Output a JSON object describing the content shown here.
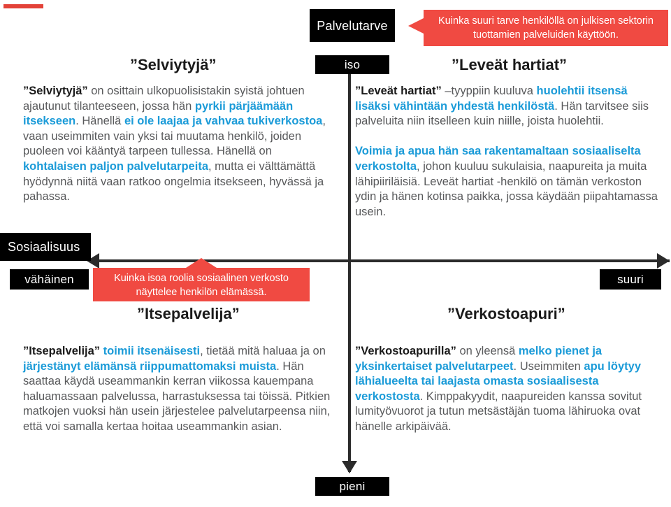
{
  "accent_color": "#e34238",
  "highlight_color": "#1b9bd8",
  "callout_color": "#f04a42",
  "axes": {
    "vertical_title": "Palvelutarve",
    "vertical_top_label": "iso",
    "vertical_bottom_label": "pieni",
    "horizontal_title": "Sosiaalisuus",
    "horizontal_left_label": "vähäinen",
    "horizontal_right_label": "suuri"
  },
  "callouts": {
    "service_need": "Kuinka suuri tarve henkilöllä on julkisen sektorin tuottamien palveluiden käyttöön.",
    "sociality": "Kuinka isoa roolia sosiaalinen verkosto näyttelee henkilön elämässä."
  },
  "quadrants": {
    "top_left": {
      "heading": "”Selviytyjä”",
      "body_parts": [
        {
          "text": "”Selviytyjä”",
          "style": "bold-dark"
        },
        {
          "text": " on osittain ulkopuolisistakin syistä johtuen ajautunut tilanteeseen, jossa hän ",
          "style": "plain"
        },
        {
          "text": "pyrkii pärjäämään itsekseen",
          "style": "highlight"
        },
        {
          "text": ". Hänellä ",
          "style": "plain"
        },
        {
          "text": "ei ole laajaa ja vahvaa tukiverkostoa",
          "style": "highlight"
        },
        {
          "text": ", vaan useimmiten vain yksi tai muutama henkilö, joiden puoleen voi kääntyä tarpeen tullessa. Hänellä on ",
          "style": "plain"
        },
        {
          "text": "kohtalaisen paljon palvelutarpeita",
          "style": "highlight"
        },
        {
          "text": ", mutta ei välttämättä hyödynnä niitä vaan ratkoo ongelmia itsekseen, hyvässä ja pahassa.",
          "style": "plain"
        }
      ]
    },
    "top_right": {
      "heading": "”Leveät hartiat”",
      "body_parts": [
        {
          "text": "”Leveät hartiat”",
          "style": "bold-dark"
        },
        {
          "text": " –tyyppiin kuuluva ",
          "style": "plain"
        },
        {
          "text": "huolehtii itsensä lisäksi vähintään yhdestä henkilöstä",
          "style": "highlight"
        },
        {
          "text": ". Hän tarvitsee siis palveluita niin itselleen kuin niille, joista huolehtii.",
          "style": "plain"
        },
        {
          "text": "\n\n",
          "style": "break"
        },
        {
          "text": "Voimia ja apua hän saa rakentamaltaan sosiaaliselta verkostolta",
          "style": "highlight"
        },
        {
          "text": ", johon kuuluu sukulaisia, naapureita ja muita lähipiiriläisiä. Leveät hartiat -henkilö on tämän verkoston ydin ja hänen kotinsa paikka, jossa käydään piipahtamassa usein.",
          "style": "plain"
        }
      ]
    },
    "bottom_left": {
      "heading": "”Itsepalvelija”",
      "body_parts": [
        {
          "text": "”Itsepalvelija”",
          "style": "bold-dark"
        },
        {
          "text": " ",
          "style": "plain"
        },
        {
          "text": "toimii itsenäisesti",
          "style": "highlight"
        },
        {
          "text": ", tietää mitä haluaa ja on ",
          "style": "plain"
        },
        {
          "text": "järjestänyt elämänsä riippumattomaksi muista",
          "style": "highlight"
        },
        {
          "text": ". Hän saattaa käydä useammankin kerran viikossa kauempana haluamassaan palvelussa, harrastuksessa tai töissä. Pitkien matkojen vuoksi hän usein järjestelee palvelutarpeensa niin, että voi samalla kertaa hoitaa useammankin asian.",
          "style": "plain"
        }
      ]
    },
    "bottom_right": {
      "heading": "”Verkostoapuri”",
      "body_parts": [
        {
          "text": "”Verkostoapurilla”",
          "style": "bold-dark"
        },
        {
          "text": " on yleensä ",
          "style": "plain"
        },
        {
          "text": "melko pienet ja yksinkertaiset palvelutarpeet",
          "style": "highlight"
        },
        {
          "text": ". Useimmiten ",
          "style": "plain"
        },
        {
          "text": "apu löytyy lähialueelta tai laajasta omasta sosiaalisesta verkostosta",
          "style": "highlight"
        },
        {
          "text": ". Kimppakyydit, naapureiden kanssa sovitut lumityövuorot ja tutun metsästäjän tuoma lähiruoka ovat hänelle arkipäivää.",
          "style": "plain"
        }
      ]
    }
  }
}
